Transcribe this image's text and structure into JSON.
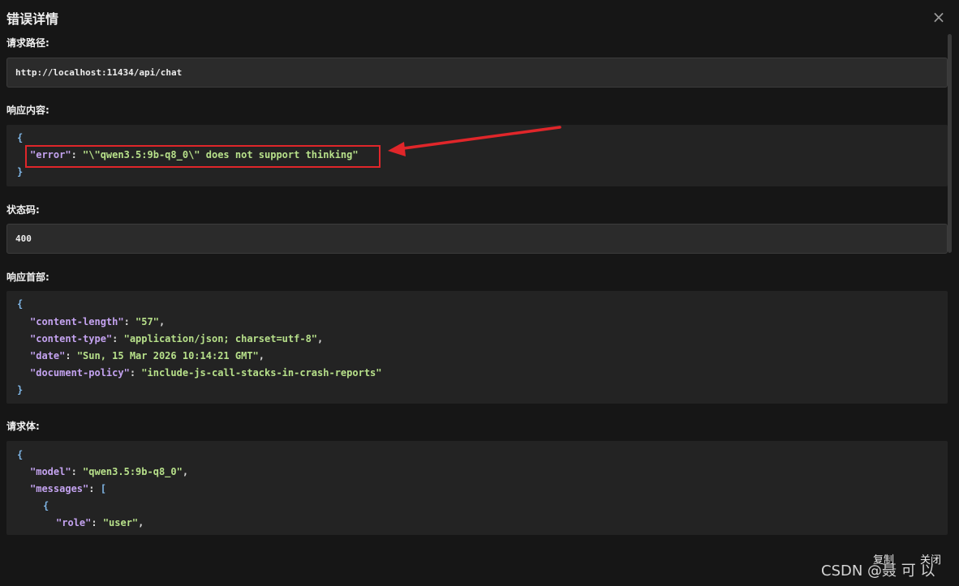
{
  "dialog": {
    "title": "错误详情",
    "close_glyph": "×"
  },
  "request_path": {
    "label": "请求路径:",
    "value": "http://localhost:11434/api/chat"
  },
  "response_body": {
    "label": "响应内容:",
    "open": "{",
    "key": "\"error\"",
    "sep": ": ",
    "value": "\"\\\"qwen3.5:9b-q8_0\\\" does not support thinking\"",
    "close": "}"
  },
  "status_code": {
    "label": "状态码:",
    "value": "400"
  },
  "response_headers": {
    "label": "响应首部:",
    "open": "{",
    "close": "}",
    "lines": [
      {
        "key": "\"content-length\"",
        "value": "\"57\"",
        "tail": ","
      },
      {
        "key": "\"content-type\"",
        "value": "\"application/json; charset=utf-8\"",
        "tail": ","
      },
      {
        "key": "\"date\"",
        "value": "\"Sun, 15 Mar 2026 10:14:21 GMT\"",
        "tail": ","
      },
      {
        "key": "\"document-policy\"",
        "value": "\"include-js-call-stacks-in-crash-reports\"",
        "tail": ""
      }
    ]
  },
  "request_body": {
    "label": "请求体:",
    "open": "{",
    "model_key": "\"model\"",
    "model_value": "\"qwen3.5:9b-q8_0\"",
    "messages_key": "\"messages\"",
    "messages_open": "[",
    "item_open": "{",
    "role_key": "\"role\"",
    "role_value": "\"user\""
  },
  "footer": {
    "copy_label": "复制",
    "close_label": "关闭"
  },
  "watermark": "CSDN @聂 可 以",
  "colors": {
    "highlight_box": "#e0262a",
    "arrow": "#e0262a",
    "json_key": "#c4a3f0",
    "json_string": "#b7e08a",
    "json_brace": "#7fb6e6"
  },
  "icons": {
    "close": "close-icon",
    "annotation": "red-arrow-annotation"
  }
}
